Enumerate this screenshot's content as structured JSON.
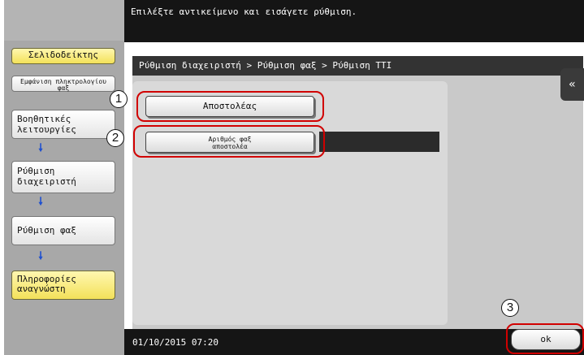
{
  "instruction": "Επιλέξτε αντικείμενο και εισάγετε ρύθμιση.",
  "sidebar": {
    "top_label": "Σελιδοδείκτης",
    "keypad_label": "Εμφάνιση πληκτρολογίου φαξ",
    "steps": [
      {
        "label": "Βοηθητικές λειτουργίες"
      },
      {
        "label": "Ρύθμιση διαχειριστή"
      },
      {
        "label": "Ρύθμιση φαξ"
      },
      {
        "label": "Πληροφορίες αναγνώστη"
      }
    ],
    "arrow_icon": "down-arrow-icon"
  },
  "breadcrumb": "Ρύθμιση διαχειριστή > Ρύθμιση φαξ > Ρύθμιση TTI",
  "main": {
    "buttons": [
      {
        "label": "Αποστολέας"
      },
      {
        "label": "Αριθμός φαξ αποστολέα"
      }
    ]
  },
  "status": {
    "datetime": "01/10/2015   07:20"
  },
  "ok_label": "ok",
  "side_tab_icon": "double-left-arrow-icon",
  "callouts": [
    "1",
    "2",
    "3"
  ],
  "colors": {
    "accent_yellow": "#f3e15a",
    "callout_red": "#d10000",
    "arrow_blue": "#1d4fd0"
  }
}
